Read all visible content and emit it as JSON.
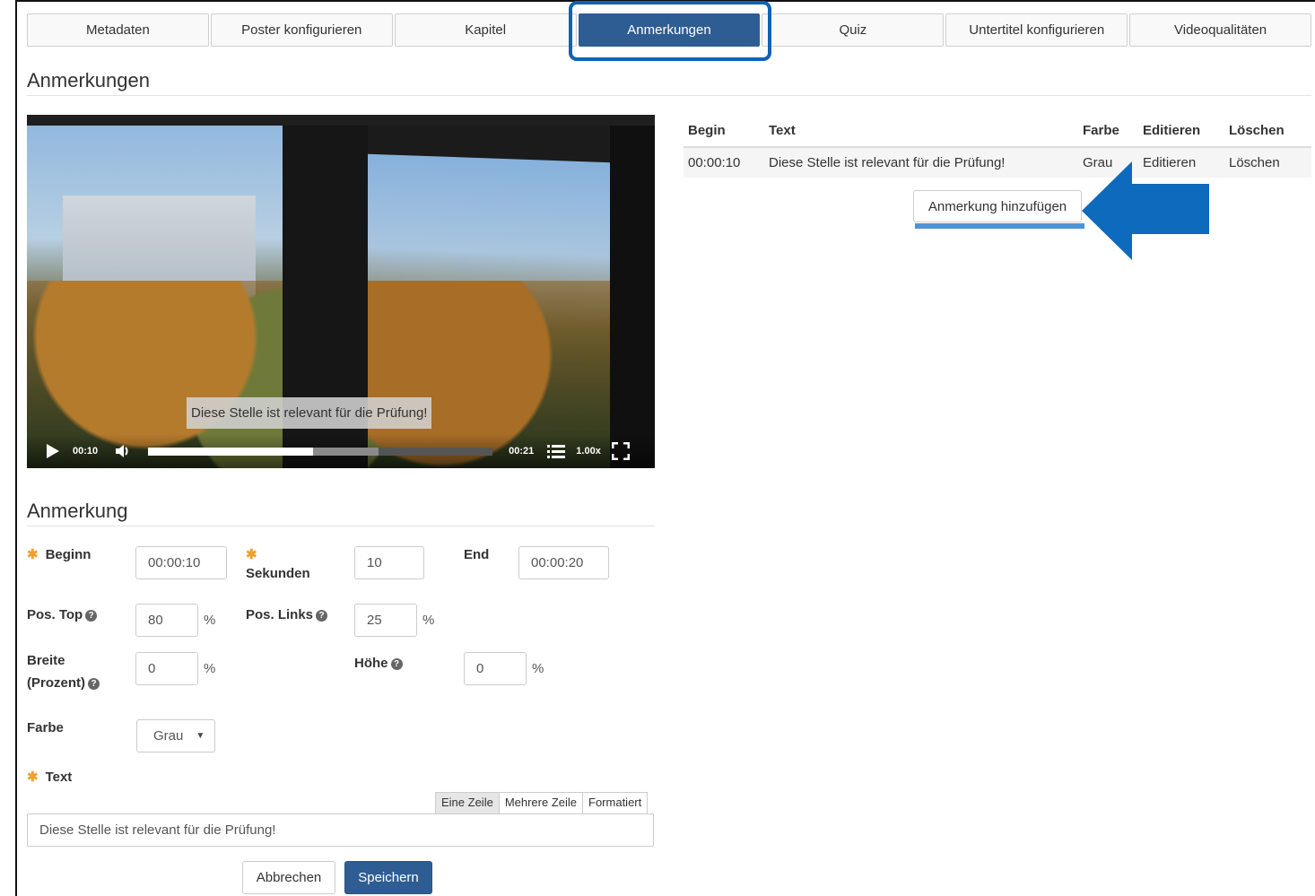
{
  "tabs": [
    {
      "label": "Metadaten",
      "active": false
    },
    {
      "label": "Poster konfigurieren",
      "active": false
    },
    {
      "label": "Kapitel",
      "active": false
    },
    {
      "label": "Anmerkungen",
      "active": true
    },
    {
      "label": "Quiz",
      "active": false
    },
    {
      "label": "Untertitel konfigurieren",
      "active": false
    },
    {
      "label": "Videoqualitäten",
      "active": false
    }
  ],
  "section_title": "Anmerkungen",
  "video": {
    "caption": "Diese Stelle ist relevant für die Prüfung!",
    "current_time": "00:10",
    "duration": "00:21",
    "speed": "1.00x",
    "progress": 0.48,
    "buffered": 0.67
  },
  "table": {
    "headers": {
      "begin": "Begin",
      "text": "Text",
      "color": "Farbe",
      "edit": "Editieren",
      "delete": "Löschen"
    },
    "rows": [
      {
        "begin": "00:00:10",
        "text": "Diese Stelle ist relevant für die Prüfung!",
        "color": "Grau",
        "edit": "Editieren",
        "delete": "Löschen"
      }
    ]
  },
  "add_button": "Anmerkung hinzufügen",
  "form": {
    "title": "Anmerkung",
    "begin_label": "Beginn",
    "begin_value": "00:00:10",
    "seconds_label": "Sekunden",
    "seconds_value": "10",
    "end_label": "End",
    "end_value": "00:00:20",
    "pos_top_label": "Pos. Top",
    "pos_top_value": "80",
    "pos_left_label": "Pos. Links",
    "pos_left_value": "25",
    "width_label_1": "Breite",
    "width_label_2": "(Prozent)",
    "width_value": "0",
    "height_label": "Höhe",
    "height_value": "0",
    "percent": "%",
    "color_label": "Farbe",
    "color_value": "Grau",
    "text_label": "Text",
    "text_modes": [
      "Eine Zeile",
      "Mehrere Zeile",
      "Formatiert"
    ],
    "text_value": "Diese Stelle ist relevant für die Prüfung!",
    "cancel": "Abbrechen",
    "save": "Speichern"
  },
  "colors": {
    "primary": "#2e5d93",
    "highlight": "#0d63b4",
    "link": "#2e6da4",
    "required": "#f0a030"
  },
  "icons": {
    "arrow": "arrow-left-icon",
    "play": "play-icon",
    "volume": "volume-icon",
    "chapters": "list-icon",
    "fullscreen": "fullscreen-icon",
    "help": "question-circle-icon"
  }
}
